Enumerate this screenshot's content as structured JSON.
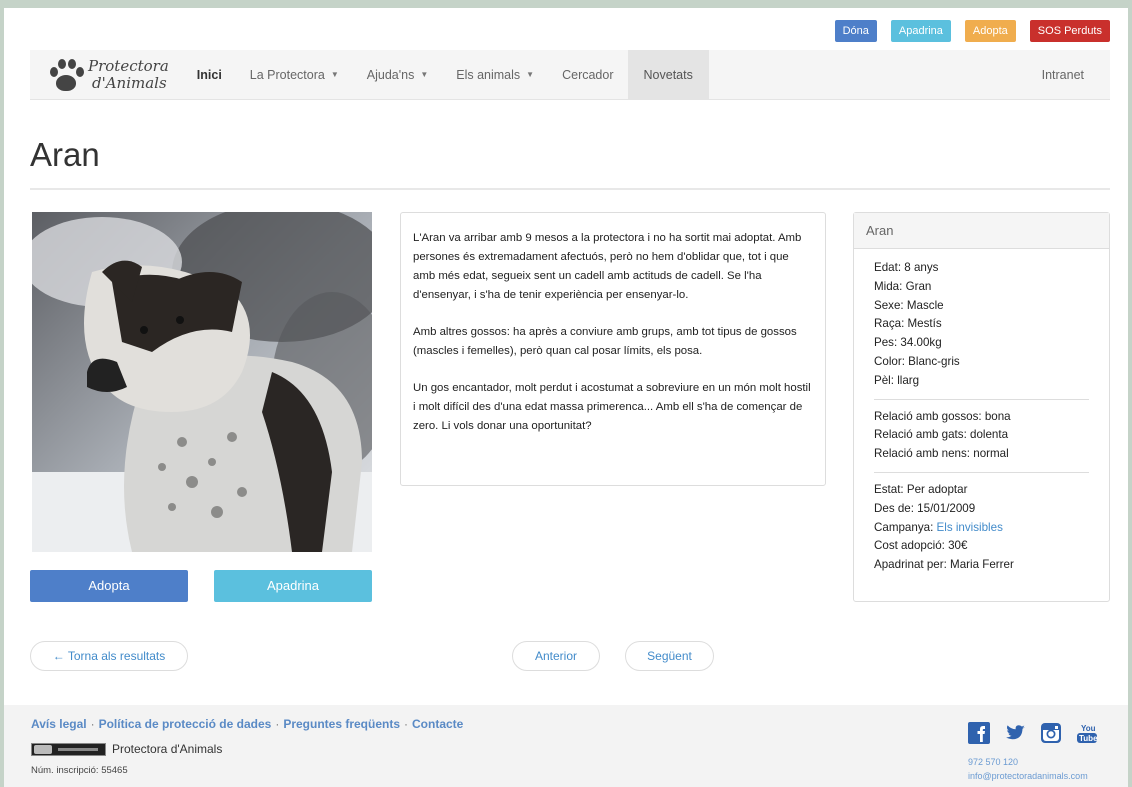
{
  "top_buttons": [
    {
      "label": "Dóna",
      "color": "#4e7fc9"
    },
    {
      "label": "Apadrina",
      "color": "#5bc0de"
    },
    {
      "label": "Adopta",
      "color": "#f0ad4e"
    },
    {
      "label": "SOS Perduts",
      "color": "#c9302c"
    }
  ],
  "brand": {
    "line1": "Protectora",
    "line2": "d'Animals"
  },
  "nav": {
    "items": [
      {
        "label": "Inici",
        "dropdown": false
      },
      {
        "label": "La Protectora",
        "dropdown": true
      },
      {
        "label": "Ajuda'ns",
        "dropdown": true
      },
      {
        "label": "Els animals",
        "dropdown": true
      },
      {
        "label": "Cercador",
        "dropdown": false
      },
      {
        "label": "Novetats",
        "dropdown": false
      }
    ],
    "right": "Intranet"
  },
  "animal": {
    "name": "Aran",
    "description": [
      "L'Aran va arribar amb 9 mesos a la protectora i no ha sortit mai adoptat. Amb persones és extremadament afectuós, però no hem d'oblidar que, tot i que amb més edat, segueix sent un cadell amb actituds de cadell. Se l'ha d'ensenyar, i s'ha de tenir experiència per ensenyar-lo.",
      "Amb altres gossos: ha après a conviure amb grups, amb tot tipus de gossos (mascles i femelles), però quan cal posar límits, els posa.",
      "Un gos encantador, molt perdut i acostumat a sobreviure en un món molt hostil i molt difícil des d'una edat massa primerenca... Amb ell s'ha de començar de zero. Li vols donar una oportunitat?"
    ],
    "details": {
      "age": "Edat: 8 anys",
      "size": "Mida: Gran",
      "sex": "Sexe: Mascle",
      "breed": "Raça: Mestís",
      "weight": "Pes: 34.00kg",
      "color": "Color: Blanc-gris",
      "coat": "Pèl: llarg"
    },
    "relations": {
      "dogs": "Relació amb gossos: bona",
      "cats": "Relació amb gats: dolenta",
      "kids": "Relació amb nens: normal"
    },
    "status": {
      "state": "Estat: Per adoptar",
      "since": "Des de: 15/01/2009",
      "campaign_label": "Campanya: ",
      "campaign_link": "Els invisibles",
      "cost": "Cost adopció: 30€",
      "sponsor": "Apadrinat per: Maria Ferrer"
    }
  },
  "actions": {
    "adopt": "Adopta",
    "sponsor": "Apadrina"
  },
  "pager": {
    "back": "← Torna als resultats",
    "prev": "Anterior",
    "next": "Següent"
  },
  "footer": {
    "links": [
      "Avís legal",
      "Política de protecció de dades",
      "Preguntes freqüents",
      "Contacte"
    ],
    "separator": "·",
    "org": "Protectora d'Animals",
    "registration": "Núm. inscripció: 55465",
    "phone": "972 570 120",
    "email": "info@protectoradanimals.com",
    "social_icons": [
      "facebook-icon",
      "twitter-icon",
      "instagram-icon",
      "youtube-icon"
    ]
  }
}
